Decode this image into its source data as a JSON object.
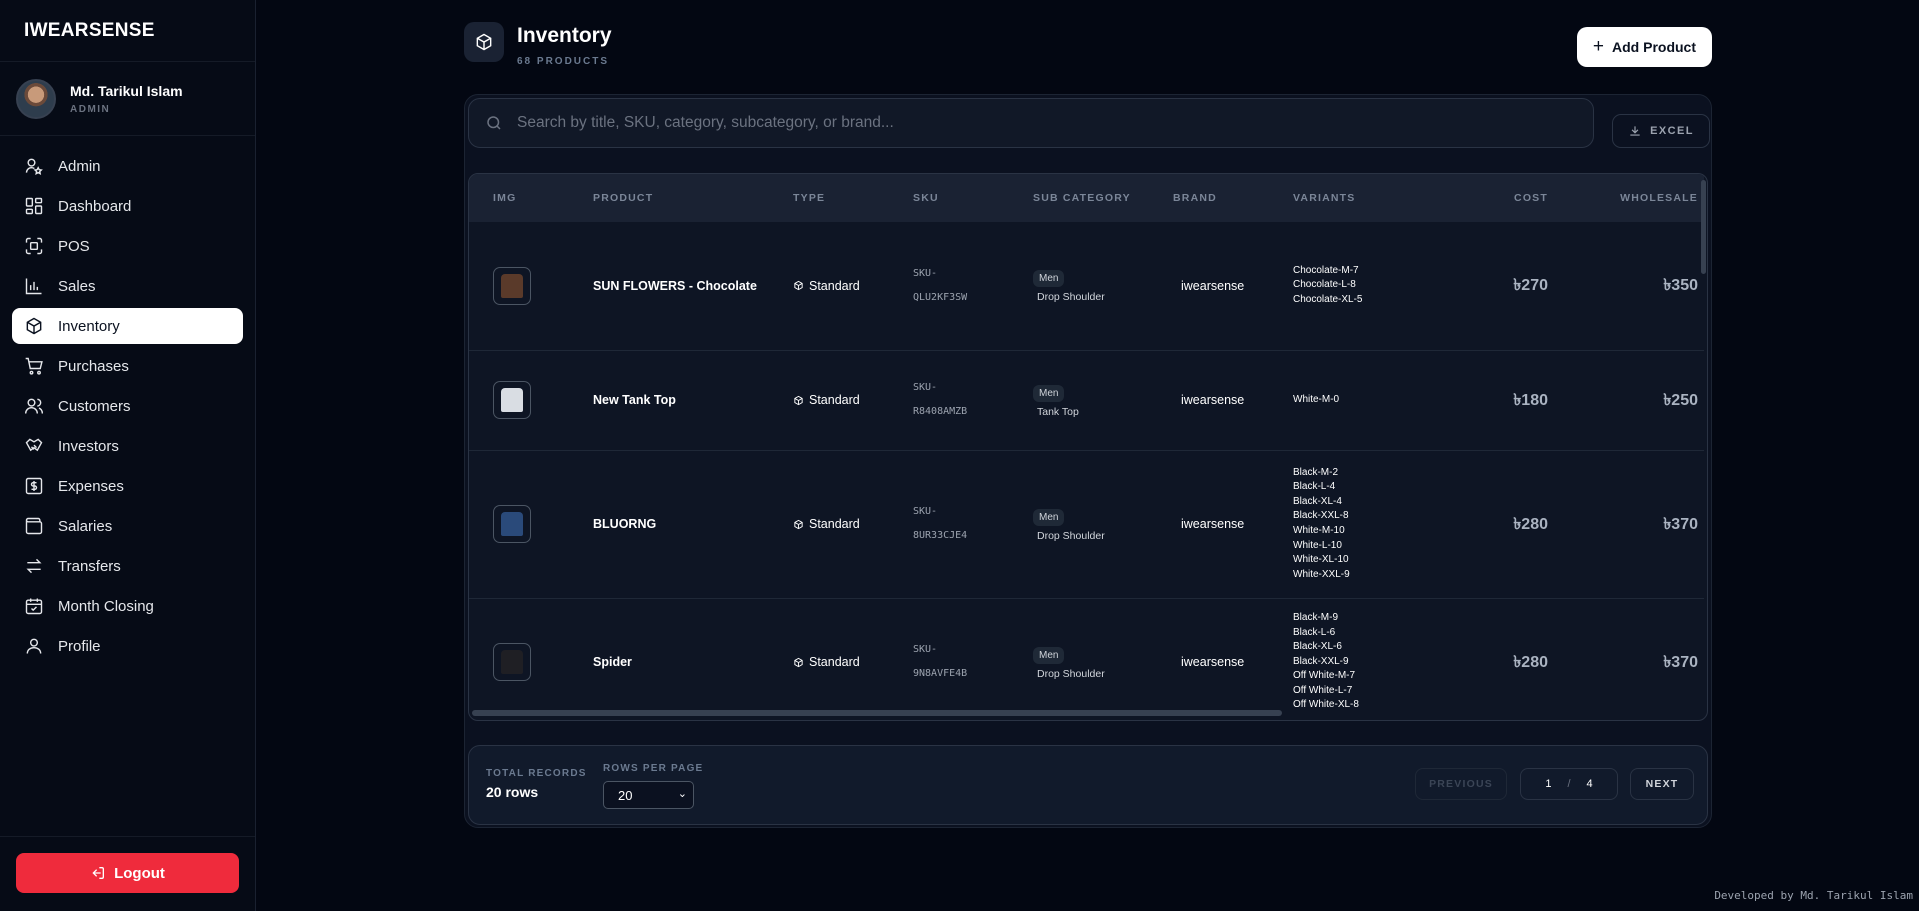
{
  "app": {
    "brand": "IWEARSENSE"
  },
  "user": {
    "name": "Md. Tarikul Islam",
    "role": "ADMIN"
  },
  "nav": [
    {
      "label": "Admin",
      "icon": "user-star-icon"
    },
    {
      "label": "Dashboard",
      "icon": "dashboard-icon"
    },
    {
      "label": "POS",
      "icon": "scan-icon"
    },
    {
      "label": "Sales",
      "icon": "bar-chart-icon"
    },
    {
      "label": "Inventory",
      "icon": "package-icon",
      "active": true
    },
    {
      "label": "Purchases",
      "icon": "cart-icon"
    },
    {
      "label": "Customers",
      "icon": "users-icon"
    },
    {
      "label": "Investors",
      "icon": "handshake-icon"
    },
    {
      "label": "Expenses",
      "icon": "dollar-icon"
    },
    {
      "label": "Salaries",
      "icon": "wallet-icon"
    },
    {
      "label": "Transfers",
      "icon": "transfer-icon"
    },
    {
      "label": "Month Closing",
      "icon": "calendar-icon"
    },
    {
      "label": "Profile",
      "icon": "user-icon"
    }
  ],
  "logout_label": "Logout",
  "header": {
    "title": "Inventory",
    "subtitle": "68 PRODUCTS",
    "add_label": "Add Product"
  },
  "search": {
    "placeholder": "Search by title, SKU, category, subcategory, or brand..."
  },
  "excel_label": "EXCEL",
  "table": {
    "columns": [
      "IMG",
      "PRODUCT",
      "TYPE",
      "SKU",
      "SUB CATEGORY",
      "BRAND",
      "VARIANTS",
      "COST",
      "WHOLESALE"
    ],
    "rows": [
      {
        "name": "SUN FLOWERS - Chocolate",
        "type": "Standard",
        "sku1": "SKU-",
        "sku2": "QLU2KF3SW",
        "category": "Men",
        "subcategory": "Drop Shoulder",
        "brand": "iwearsense",
        "variants": [
          "Chocolate-M-7",
          "Chocolate-L-8",
          "Chocolate-XL-5"
        ],
        "cost": "৳270",
        "wholesale": "৳350",
        "thumb_color": "#5a3a2a"
      },
      {
        "name": "New Tank Top",
        "type": "Standard",
        "sku1": "SKU-",
        "sku2": "R8408AMZB",
        "category": "Men",
        "subcategory": "Tank Top",
        "brand": "iwearsense",
        "variants": [
          "White-M-0"
        ],
        "cost": "৳180",
        "wholesale": "৳250",
        "thumb_color": "#d9dde3"
      },
      {
        "name": "BLUORNG",
        "type": "Standard",
        "sku1": "SKU-",
        "sku2": "8UR33CJE4",
        "category": "Men",
        "subcategory": "Drop Shoulder",
        "brand": "iwearsense",
        "variants": [
          "Black-M-2",
          "Black-L-4",
          "Black-XL-4",
          "Black-XXL-8",
          "White-M-10",
          "White-L-10",
          "White-XL-10",
          "White-XXL-9"
        ],
        "cost": "৳280",
        "wholesale": "৳370",
        "thumb_color": "#2a4a7a"
      },
      {
        "name": "Spider",
        "type": "Standard",
        "sku1": "SKU-",
        "sku2": "9N8AVFE4B",
        "category": "Men",
        "subcategory": "Drop Shoulder",
        "brand": "iwearsense",
        "variants": [
          "Black-M-9",
          "Black-L-6",
          "Black-XL-6",
          "Black-XXL-9",
          "Off White-M-7",
          "Off White-L-7",
          "Off White-XL-8"
        ],
        "cost": "৳280",
        "wholesale": "৳370",
        "thumb_color": "#1f1f24"
      }
    ]
  },
  "footer": {
    "total_label": "TOTAL RECORDS",
    "total_value": "20 rows",
    "rows_label": "ROWS PER PAGE",
    "rows_value": "20",
    "prev_label": "PREVIOUS",
    "page_current": "1",
    "page_sep": "/",
    "page_total": "4",
    "next_label": "NEXT"
  },
  "credit": "Developed by Md. Tarikul Islam"
}
